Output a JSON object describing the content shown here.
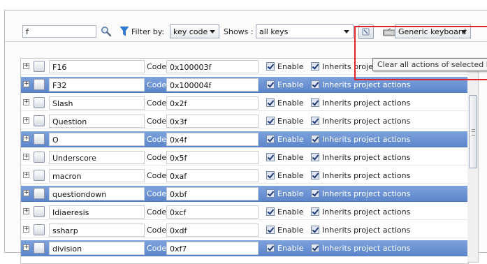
{
  "toolbar": {
    "search_value": "f",
    "filter_label": "Filter by:",
    "filter_value": "key code",
    "shows_label": "Shows :",
    "shows_value": "all keys",
    "device_value": "Generic keyboard",
    "tooltip": "Clear all actions of selected key"
  },
  "colors": {
    "selection": "#6b93d6",
    "highlight_box": "#e0222b"
  },
  "icons": {
    "search": "magnifier-icon",
    "filter": "funnel-icon",
    "clear": "clear-actions-icon",
    "device": "keyboard-icon"
  },
  "list": {
    "code_label": "Code",
    "enable_label": "Enable",
    "inherits_label": "Inherits project actions",
    "rows": [
      {
        "name": "F16",
        "code": "0x100003f",
        "selected": false
      },
      {
        "name": "F32",
        "code": "0x100004f",
        "selected": true
      },
      {
        "name": "Slash",
        "code": "0x2f",
        "selected": false
      },
      {
        "name": "Question",
        "code": "0x3f",
        "selected": false
      },
      {
        "name": "O",
        "code": "0x4f",
        "selected": true
      },
      {
        "name": "Underscore",
        "code": "0x5f",
        "selected": false
      },
      {
        "name": "macron",
        "code": "0xaf",
        "selected": false
      },
      {
        "name": "questiondown",
        "code": "0xbf",
        "selected": true
      },
      {
        "name": "Idiaeresis",
        "code": "0xcf",
        "selected": false
      },
      {
        "name": "ssharp",
        "code": "0xdf",
        "selected": false
      },
      {
        "name": "division",
        "code": "0xf7",
        "selected": true
      }
    ]
  }
}
